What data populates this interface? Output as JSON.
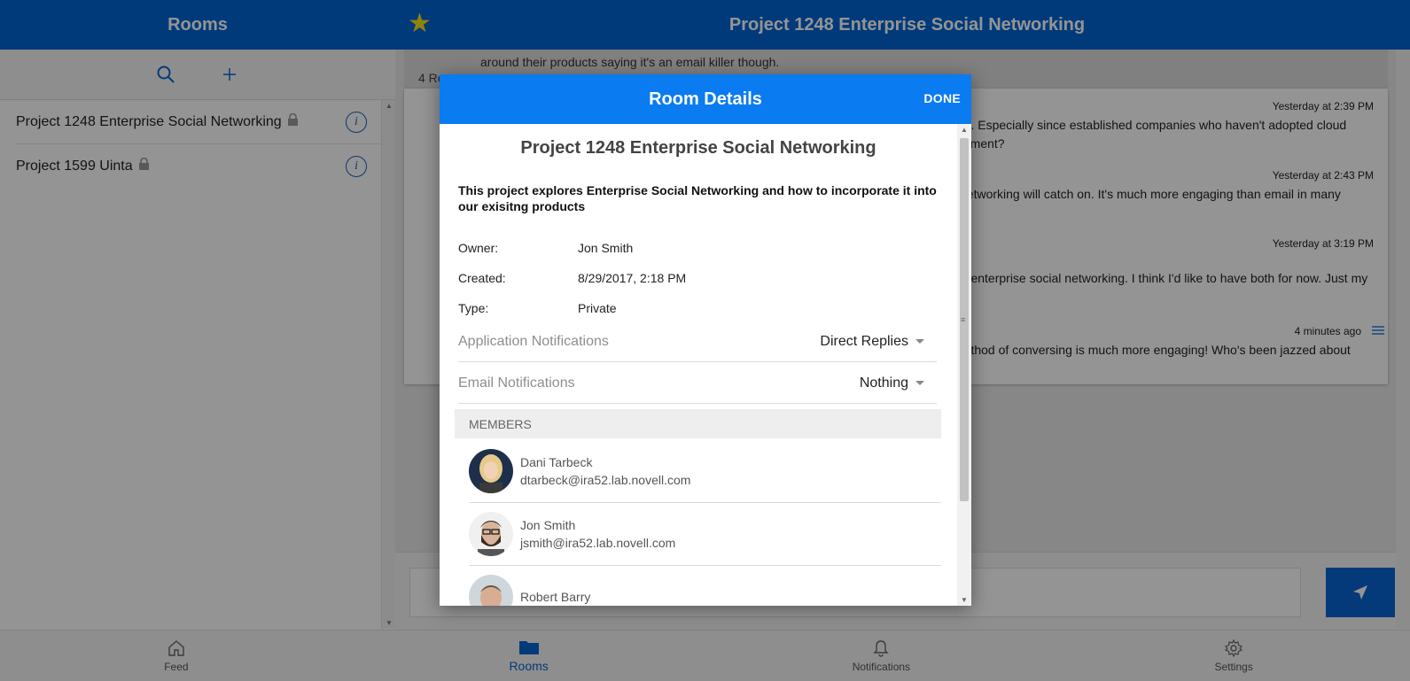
{
  "sidebar": {
    "title": "Rooms",
    "rooms": [
      {
        "name": "Project 1248 Enterprise Social Networking"
      },
      {
        "name": "Project 1599 Uinta"
      }
    ]
  },
  "room_header": {
    "title": "Project 1248 Enterprise Social Networking"
  },
  "chat": {
    "prev_line": "around their products saying it's an email killer though.",
    "replies_label": "4 Re",
    "messages": [
      {
        "time": "Yesterday at 2:39 PM",
        "body": "oth. Especially since established companies who haven't adopted cloud estment?"
      },
      {
        "time": "Yesterday at 2:43 PM",
        "body": "l networking will catch on. It's much more engaging than email in many"
      },
      {
        "time": "Yesterday at 3:19 PM",
        "body": "nd enterprise social networking. I think I'd like to have both for now. Just my"
      },
      {
        "time": "4 minutes ago",
        "body": "method of conversing is much more engaging! Who's been jazzed about"
      }
    ]
  },
  "nav": {
    "items": [
      {
        "label": "Feed"
      },
      {
        "label": "Rooms"
      },
      {
        "label": "Notifications"
      },
      {
        "label": "Settings"
      }
    ]
  },
  "modal": {
    "title": "Room Details",
    "done_label": "DONE",
    "room_name": "Project 1248 Enterprise Social Networking",
    "description": "This project explores Enterprise Social Networking and how to incorporate it into our exisitng products",
    "owner_label": "Owner:",
    "owner": "Jon Smith",
    "created_label": "Created:",
    "created": "8/29/2017, 2:18 PM",
    "type_label": "Type:",
    "type": "Private",
    "app_notif_label": "Application Notifications",
    "app_notif_value": "Direct Replies",
    "email_notif_label": "Email Notifications",
    "email_notif_value": "Nothing",
    "members_label": "MEMBERS",
    "members": [
      {
        "name": "Dani Tarbeck",
        "email": "dtarbeck@ira52.lab.novell.com"
      },
      {
        "name": "Jon Smith",
        "email": "jsmith@ira52.lab.novell.com"
      },
      {
        "name": "Robert Barry",
        "email": ""
      }
    ]
  },
  "colors": {
    "brand_blue": "#0064d2",
    "modal_header_blue": "#0a7bf0",
    "star_yellow": "#f7e316"
  }
}
